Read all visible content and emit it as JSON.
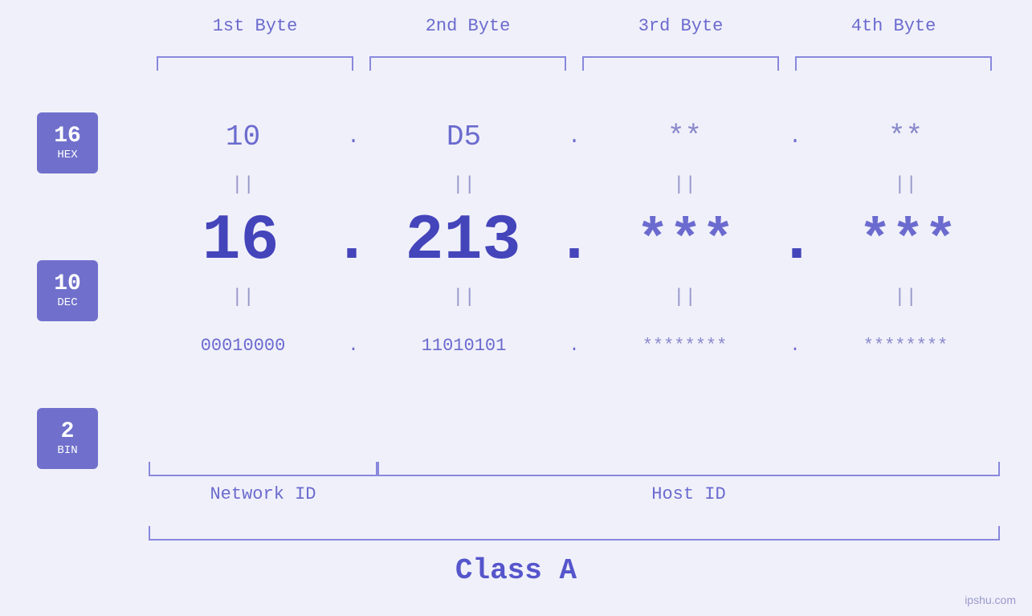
{
  "columns": {
    "headers": [
      "1st Byte",
      "2nd Byte",
      "3rd Byte",
      "4th Byte"
    ]
  },
  "badges": [
    {
      "num": "16",
      "label": "HEX"
    },
    {
      "num": "10",
      "label": "DEC"
    },
    {
      "num": "2",
      "label": "BIN"
    }
  ],
  "hex_row": {
    "values": [
      "10",
      "D5",
      "**",
      "**"
    ],
    "dots": [
      ".",
      ".",
      ".",
      ""
    ]
  },
  "dec_row": {
    "values": [
      "16",
      "213",
      "***",
      "***"
    ],
    "dots": [
      ".",
      ".",
      ".",
      ""
    ]
  },
  "bin_row": {
    "values": [
      "00010000",
      "11010101",
      "********",
      "********"
    ],
    "dots": [
      ".",
      ".",
      ".",
      ""
    ]
  },
  "labels": {
    "network_id": "Network ID",
    "host_id": "Host ID",
    "class": "Class A"
  },
  "watermark": "ipshu.com",
  "equals": [
    "||",
    "||",
    "||",
    "||"
  ]
}
